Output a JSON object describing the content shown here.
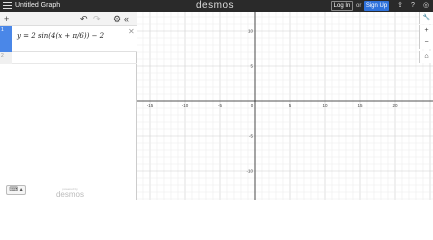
{
  "topbar": {
    "title": "Untitled Graph",
    "brand": "desmos",
    "login_label": "Log In",
    "or_label": "or",
    "signup_label": "Sign Up",
    "icons": [
      "menu-icon",
      "share-icon",
      "help-icon",
      "globe-icon"
    ]
  },
  "toolbar": {
    "add_label": "+",
    "undo_label": "↶",
    "redo_label": "↷",
    "settings_label": "⚙",
    "collapse_label": "«"
  },
  "expressions": [
    {
      "index": "1",
      "latex": "y = 2 sin(4(x + π/6)) − 2",
      "color": "#4a87e8"
    },
    {
      "index": "2",
      "latex": ""
    }
  ],
  "footer": {
    "keyboard_label": "⌨ ▴",
    "powered_by": "powered by",
    "logo": "desmos"
  },
  "graph_controls": {
    "zoom_in": "+",
    "zoom_out": "−",
    "home": "⌂",
    "settings": "🔧"
  },
  "axes": {
    "x_ticks": [
      "-15",
      "-10",
      "-5",
      "0",
      "5",
      "10",
      "15",
      "20"
    ],
    "y_ticks": [
      "10",
      "5",
      "-5",
      "-10"
    ],
    "x_range": [
      -17.5,
      24
    ],
    "y_range": [
      -13,
      13
    ]
  }
}
